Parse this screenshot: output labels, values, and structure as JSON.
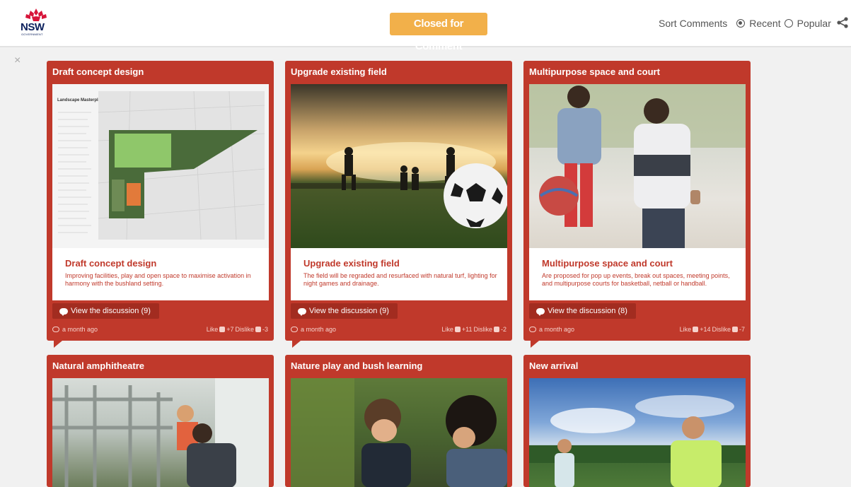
{
  "header": {
    "logo_text": "NSW",
    "logo_sub": "GOVERNMENT",
    "status_button": "Closed for Comment",
    "sort_label": "Sort Comments",
    "sort_recent": "Recent",
    "sort_popular": "Popular"
  },
  "close_symbol": "×",
  "cards": [
    {
      "title": "Draft concept design",
      "panel_title": "Draft concept design",
      "panel_desc": "Improving facilities, play and open space to maximise activation in harmony with the bushland setting.",
      "plan_heading": "Landscape Masterplan",
      "discussion": "View the discussion (9)",
      "time": "a month ago",
      "like_label": "Like",
      "like_count": "+7",
      "dislike_label": "Dislike",
      "dislike_count": "-3"
    },
    {
      "title": "Upgrade existing field",
      "panel_title": "Upgrade existing field",
      "panel_desc": "The field will be regraded and resurfaced with natural turf, lighting for night games and drainage.",
      "discussion": "View the discussion (9)",
      "time": "a month ago",
      "like_label": "Like",
      "like_count": "+11",
      "dislike_label": "Dislike",
      "dislike_count": "-2"
    },
    {
      "title": "Multipurpose space and court",
      "panel_title": "Multipurpose space and court",
      "panel_desc": "Are proposed for pop up events, break out spaces, meeting points, and multipurpose courts for basketball, netball or handball.",
      "discussion": "View the discussion (8)",
      "time": "a month ago",
      "like_label": "Like",
      "like_count": "+14",
      "dislike_label": "Dislike",
      "dislike_count": "-7"
    },
    {
      "title": "Natural amphitheatre"
    },
    {
      "title": "Nature play and bush learning"
    },
    {
      "title": "New arrival"
    }
  ],
  "colors": {
    "card_red": "#c0392b",
    "button_dark_red": "#a22c20",
    "status_orange": "#f2b04a",
    "logo_navy": "#0a1f5c"
  }
}
